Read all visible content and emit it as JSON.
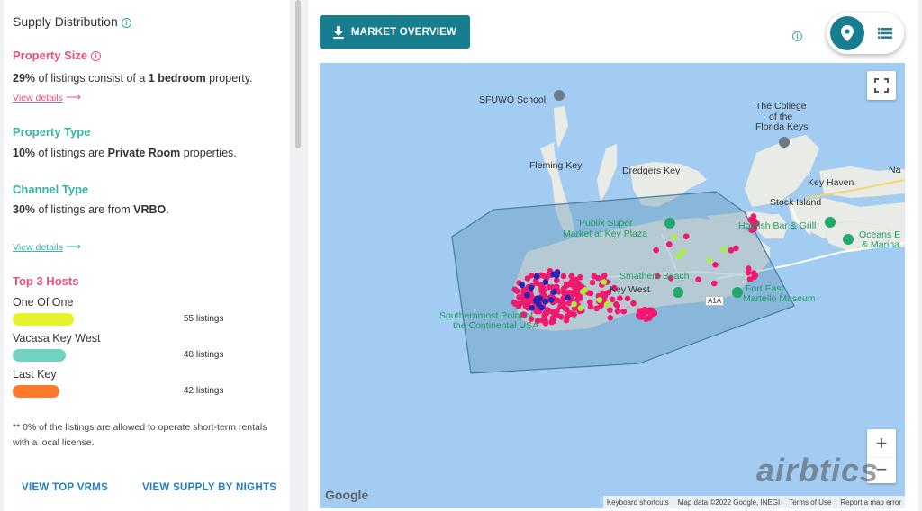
{
  "panel": {
    "title": "Supply Distribution",
    "property_size": {
      "title": "Property Size",
      "percent": "29%",
      "text_mid": " of listings consist of a ",
      "value": "1 bedroom",
      "text_end": " property.",
      "link": "View details"
    },
    "property_type": {
      "title": "Property Type",
      "percent": "10%",
      "text_mid": " of listings are ",
      "value": "Private Room",
      "text_end": " properties."
    },
    "channel_type": {
      "title": "Channel Type",
      "percent": "30%",
      "text_mid": " of listings are from ",
      "value": "VRBO",
      "text_end": ".",
      "link": "View details"
    },
    "top_hosts": {
      "title": "Top 3 Hosts",
      "hosts": [
        {
          "name": "One Of One",
          "count": "55 listings",
          "color": "#e8f22a",
          "fill": 1.0
        },
        {
          "name": "Vacasa Key West",
          "count": "48 listings",
          "color": "#6fd3bf",
          "fill": 0.873
        },
        {
          "name": "Last Key",
          "count": "42 listings",
          "color": "#fb7a2b",
          "fill": 0.764
        }
      ]
    },
    "footnote": "** 0% of the listings are allowed to operate short-term rentals with a local license.",
    "buttons": {
      "top_vrms": "VIEW TOP VRMS",
      "supply_nights": "VIEW SUPPLY BY NIGHTS"
    }
  },
  "toolbar": {
    "market_overview": "MARKET OVERVIEW",
    "map_view_icon": "map-pin-icon",
    "list_view_icon": "list-icon"
  },
  "map": {
    "labels": {
      "sfuwo": "SFUWO School",
      "college_1": "The College",
      "college_2": "of the",
      "college_3": "Florida Keys",
      "fleming": "Fleming Key",
      "dredgers": "Dredgers Key",
      "key_haven": "Key Haven",
      "stock": "Stock Island",
      "publix_1": "Publix Super",
      "publix_2": "Market at Key Plaza",
      "hogfish": "Hogfish Bar & Grill",
      "oceans_1": "Oceans E",
      "oceans_2": "& Marina",
      "smathers": "Smathers Beach",
      "key_west": "Key West",
      "fort_1": "Fort East",
      "fort_2": "Martello Museum",
      "southernmost_1": "Southernmost Point of",
      "southernmost_2": "the Continental USA",
      "road_a1a": "A1A",
      "na": "Na"
    },
    "watermark": "airbtics",
    "google": "Google",
    "attribution": [
      "Keyboard shortcuts",
      "Map data ©2022 Google, INEGI",
      "Terms of Use",
      "Report a map error"
    ],
    "colors": {
      "water": "#a3ccf3",
      "land": "#e8ebe6",
      "pink_dots": "#f0196f",
      "blue_dots": "#2323b5",
      "lime_dots": "#a8f03a"
    }
  }
}
